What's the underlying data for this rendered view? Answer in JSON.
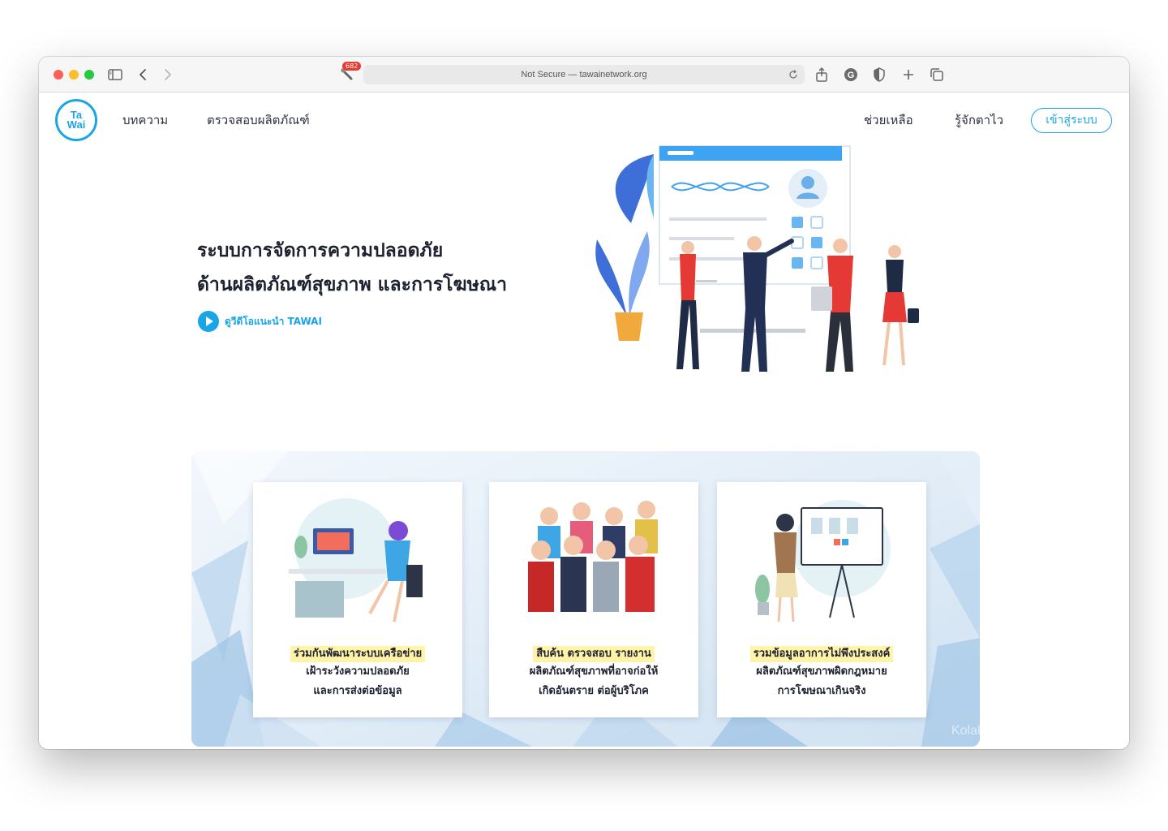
{
  "browser": {
    "url_text": "Not Secure — tawainetwork.org",
    "extension_badge": "682"
  },
  "header": {
    "logo_line1": "Ta",
    "logo_line2": "Wai",
    "nav_left": [
      "บทความ",
      "ตรวจสอบผลิตภัณฑ์"
    ],
    "nav_right": [
      "ช่วยเหลือ",
      "รู้จักตาไว"
    ],
    "login_label": "เข้าสู่ระบบ"
  },
  "hero": {
    "title_line1": "ระบบการจัดการความปลอดภัย",
    "title_line2": "ด้านผลิตภัณฑ์สุขภาพ และการโฆษณา",
    "video_link": "ดูวีดีโอแนะนำ TAWAI"
  },
  "features": [
    {
      "highlight": "ร่วมกันพัฒนาระบบเครือข่าย",
      "line2": "เฝ้าระวังความปลอดภัย",
      "line3": "และการส่งต่อข้อมูล"
    },
    {
      "highlight": "สืบค้น ตรวจสอบ รายงาน",
      "line2": "ผลิตภัณฑ์สุขภาพที่อาจก่อให้",
      "line3": "เกิดอันตราย ต่อผู้บริโภค"
    },
    {
      "highlight": "รวมข้อมูลอาการไม่พึงประสงค์",
      "line2": "ผลิตภัณฑ์สุขภาพผิดกฎหมาย",
      "line3": "การโฆษณาเกินจริง"
    }
  ],
  "watermark": "Kolak Keeratipattarakul",
  "colors": {
    "accent": "#1aa5e6",
    "highlight": "#fff3a8",
    "traffic_red": "#fe5f57",
    "traffic_yellow": "#febc2e",
    "traffic_green": "#28c840"
  }
}
